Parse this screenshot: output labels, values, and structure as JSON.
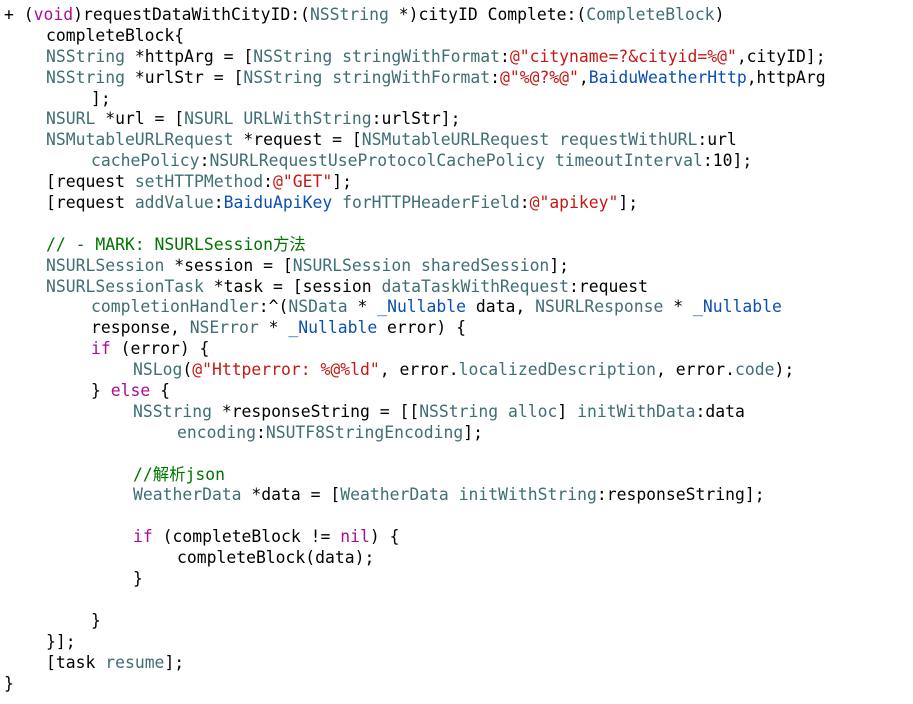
{
  "editor": {
    "colors": {
      "plain": "#000000",
      "keyword": "#aa0d91",
      "type": "#3f6e74",
      "method": "#3f6e74",
      "string": "#c41a16",
      "comment": "#007400",
      "number": "#1c00cf",
      "macro": "#0b4fb3",
      "background": "#ffffff"
    },
    "lines": [
      {
        "indent": 0,
        "tokens": [
          {
            "t": "+ (",
            "c": "plain"
          },
          {
            "t": "void",
            "c": "kw"
          },
          {
            "t": ")requestDataWithCityID:(",
            "c": "plain"
          },
          {
            "t": "NSString",
            "c": "type"
          },
          {
            "t": " *)cityID Complete:(",
            "c": "plain"
          },
          {
            "t": "CompleteBlock",
            "c": "type"
          },
          {
            "t": ")",
            "c": "plain"
          }
        ]
      },
      {
        "indent": 1,
        "tokens": [
          {
            "t": "completeBlock{",
            "c": "plain"
          }
        ]
      },
      {
        "indent": 1,
        "tokens": [
          {
            "t": "NSString",
            "c": "type"
          },
          {
            "t": " *httpArg = [",
            "c": "plain"
          },
          {
            "t": "NSString",
            "c": "type"
          },
          {
            "t": " ",
            "c": "plain"
          },
          {
            "t": "stringWithFormat",
            "c": "method"
          },
          {
            "t": ":",
            "c": "plain"
          },
          {
            "t": "@\"cityname=?&cityid=%@\"",
            "c": "string"
          },
          {
            "t": ",cityID];",
            "c": "plain"
          }
        ]
      },
      {
        "indent": 1,
        "tokens": [
          {
            "t": "NSString",
            "c": "type"
          },
          {
            "t": " *urlStr = [",
            "c": "plain"
          },
          {
            "t": "NSString",
            "c": "type"
          },
          {
            "t": " ",
            "c": "plain"
          },
          {
            "t": "stringWithFormat",
            "c": "method"
          },
          {
            "t": ":",
            "c": "plain"
          },
          {
            "t": "@\"%@?%@\"",
            "c": "string"
          },
          {
            "t": ",",
            "c": "plain"
          },
          {
            "t": "BaiduWeatherHttp",
            "c": "macro"
          },
          {
            "t": ",httpArg",
            "c": "plain"
          }
        ]
      },
      {
        "indent": 2,
        "tokens": [
          {
            "t": "];",
            "c": "plain"
          }
        ]
      },
      {
        "indent": 1,
        "tokens": [
          {
            "t": "NSURL",
            "c": "type"
          },
          {
            "t": " *url = [",
            "c": "plain"
          },
          {
            "t": "NSURL",
            "c": "type"
          },
          {
            "t": " ",
            "c": "plain"
          },
          {
            "t": "URLWithString",
            "c": "method"
          },
          {
            "t": ":urlStr];",
            "c": "plain"
          }
        ]
      },
      {
        "indent": 1,
        "tokens": [
          {
            "t": "NSMutableURLRequest",
            "c": "type"
          },
          {
            "t": " *request = [",
            "c": "plain"
          },
          {
            "t": "NSMutableURLRequest",
            "c": "type"
          },
          {
            "t": " ",
            "c": "plain"
          },
          {
            "t": "requestWithURL",
            "c": "method"
          },
          {
            "t": ":url",
            "c": "plain"
          }
        ]
      },
      {
        "indent": 2,
        "tokens": [
          {
            "t": "cachePolicy",
            "c": "method"
          },
          {
            "t": ":",
            "c": "plain"
          },
          {
            "t": "NSURLRequestUseProtocolCachePolicy",
            "c": "type"
          },
          {
            "t": " ",
            "c": "plain"
          },
          {
            "t": "timeoutInterval",
            "c": "method"
          },
          {
            "t": ":10];",
            "c": "plain"
          }
        ]
      },
      {
        "indent": 1,
        "tokens": [
          {
            "t": "[request ",
            "c": "plain"
          },
          {
            "t": "setHTTPMethod",
            "c": "method"
          },
          {
            "t": ":",
            "c": "plain"
          },
          {
            "t": "@\"GET\"",
            "c": "string"
          },
          {
            "t": "];",
            "c": "plain"
          }
        ]
      },
      {
        "indent": 1,
        "tokens": [
          {
            "t": "[request ",
            "c": "plain"
          },
          {
            "t": "addValue",
            "c": "method"
          },
          {
            "t": ":",
            "c": "plain"
          },
          {
            "t": "BaiduApiKey",
            "c": "macro"
          },
          {
            "t": " ",
            "c": "plain"
          },
          {
            "t": "forHTTPHeaderField",
            "c": "method"
          },
          {
            "t": ":",
            "c": "plain"
          },
          {
            "t": "@\"apikey\"",
            "c": "string"
          },
          {
            "t": "];",
            "c": "plain"
          }
        ]
      },
      {
        "indent": 0,
        "tokens": []
      },
      {
        "indent": 1,
        "tokens": [
          {
            "t": "// - MARK: NSURLSession方法",
            "c": "comment"
          }
        ]
      },
      {
        "indent": 1,
        "tokens": [
          {
            "t": "NSURLSession",
            "c": "type"
          },
          {
            "t": " *session = [",
            "c": "plain"
          },
          {
            "t": "NSURLSession",
            "c": "type"
          },
          {
            "t": " ",
            "c": "plain"
          },
          {
            "t": "sharedSession",
            "c": "method"
          },
          {
            "t": "];",
            "c": "plain"
          }
        ]
      },
      {
        "indent": 1,
        "tokens": [
          {
            "t": "NSURLSessionTask",
            "c": "type"
          },
          {
            "t": " *task = [session ",
            "c": "plain"
          },
          {
            "t": "dataTaskWithRequest",
            "c": "method"
          },
          {
            "t": ":request",
            "c": "plain"
          }
        ]
      },
      {
        "indent": 2,
        "tokens": [
          {
            "t": "completionHandler",
            "c": "method"
          },
          {
            "t": ":^(",
            "c": "plain"
          },
          {
            "t": "NSData",
            "c": "type"
          },
          {
            "t": " * ",
            "c": "plain"
          },
          {
            "t": "_Nullable",
            "c": "macro"
          },
          {
            "t": " data, ",
            "c": "plain"
          },
          {
            "t": "NSURLResponse",
            "c": "type"
          },
          {
            "t": " * ",
            "c": "plain"
          },
          {
            "t": "_Nullable",
            "c": "macro"
          }
        ]
      },
      {
        "indent": 2,
        "tokens": [
          {
            "t": "response, ",
            "c": "plain"
          },
          {
            "t": "NSError",
            "c": "type"
          },
          {
            "t": " * ",
            "c": "plain"
          },
          {
            "t": "_Nullable",
            "c": "macro"
          },
          {
            "t": " error) {",
            "c": "plain"
          }
        ]
      },
      {
        "indent": 2,
        "tokens": [
          {
            "t": "if",
            "c": "kw"
          },
          {
            "t": " (error) {",
            "c": "plain"
          }
        ]
      },
      {
        "indent": 3,
        "tokens": [
          {
            "t": "NSLog",
            "c": "type"
          },
          {
            "t": "(",
            "c": "plain"
          },
          {
            "t": "@\"Httperror: %@%ld\"",
            "c": "string"
          },
          {
            "t": ", error.",
            "c": "plain"
          },
          {
            "t": "localizedDescription",
            "c": "method"
          },
          {
            "t": ", error.",
            "c": "plain"
          },
          {
            "t": "code",
            "c": "method"
          },
          {
            "t": ");",
            "c": "plain"
          }
        ]
      },
      {
        "indent": 2,
        "tokens": [
          {
            "t": "} ",
            "c": "plain"
          },
          {
            "t": "else",
            "c": "kw"
          },
          {
            "t": " {",
            "c": "plain"
          }
        ]
      },
      {
        "indent": 3,
        "tokens": [
          {
            "t": "NSString",
            "c": "type"
          },
          {
            "t": " *responseString = [[",
            "c": "plain"
          },
          {
            "t": "NSString",
            "c": "type"
          },
          {
            "t": " ",
            "c": "plain"
          },
          {
            "t": "alloc",
            "c": "method"
          },
          {
            "t": "] ",
            "c": "plain"
          },
          {
            "t": "initWithData",
            "c": "method"
          },
          {
            "t": ":data",
            "c": "plain"
          }
        ]
      },
      {
        "indent": 4,
        "tokens": [
          {
            "t": "encoding",
            "c": "method"
          },
          {
            "t": ":",
            "c": "plain"
          },
          {
            "t": "NSUTF8StringEncoding",
            "c": "type"
          },
          {
            "t": "];",
            "c": "plain"
          }
        ]
      },
      {
        "indent": 0,
        "tokens": []
      },
      {
        "indent": 3,
        "tokens": [
          {
            "t": "//解析json",
            "c": "comment"
          }
        ]
      },
      {
        "indent": 3,
        "tokens": [
          {
            "t": "WeatherData",
            "c": "type"
          },
          {
            "t": " *data = [",
            "c": "plain"
          },
          {
            "t": "WeatherData",
            "c": "type"
          },
          {
            "t": " ",
            "c": "plain"
          },
          {
            "t": "initWithString",
            "c": "method"
          },
          {
            "t": ":responseString];",
            "c": "plain"
          }
        ]
      },
      {
        "indent": 0,
        "tokens": []
      },
      {
        "indent": 3,
        "tokens": [
          {
            "t": "if",
            "c": "kw"
          },
          {
            "t": " (completeBlock != ",
            "c": "plain"
          },
          {
            "t": "nil",
            "c": "kw"
          },
          {
            "t": ") {",
            "c": "plain"
          }
        ]
      },
      {
        "indent": 4,
        "tokens": [
          {
            "t": "completeBlock(data);",
            "c": "plain"
          }
        ]
      },
      {
        "indent": 3,
        "tokens": [
          {
            "t": "}",
            "c": "plain"
          }
        ]
      },
      {
        "indent": 0,
        "tokens": []
      },
      {
        "indent": 2,
        "tokens": [
          {
            "t": "}",
            "c": "plain"
          }
        ]
      },
      {
        "indent": 1,
        "tokens": [
          {
            "t": "}];",
            "c": "plain"
          }
        ]
      },
      {
        "indent": 1,
        "tokens": [
          {
            "t": "[task ",
            "c": "plain"
          },
          {
            "t": "resume",
            "c": "method"
          },
          {
            "t": "];",
            "c": "plain"
          }
        ]
      },
      {
        "indent": 0,
        "tokens": [
          {
            "t": "}",
            "c": "plain"
          }
        ]
      }
    ]
  }
}
